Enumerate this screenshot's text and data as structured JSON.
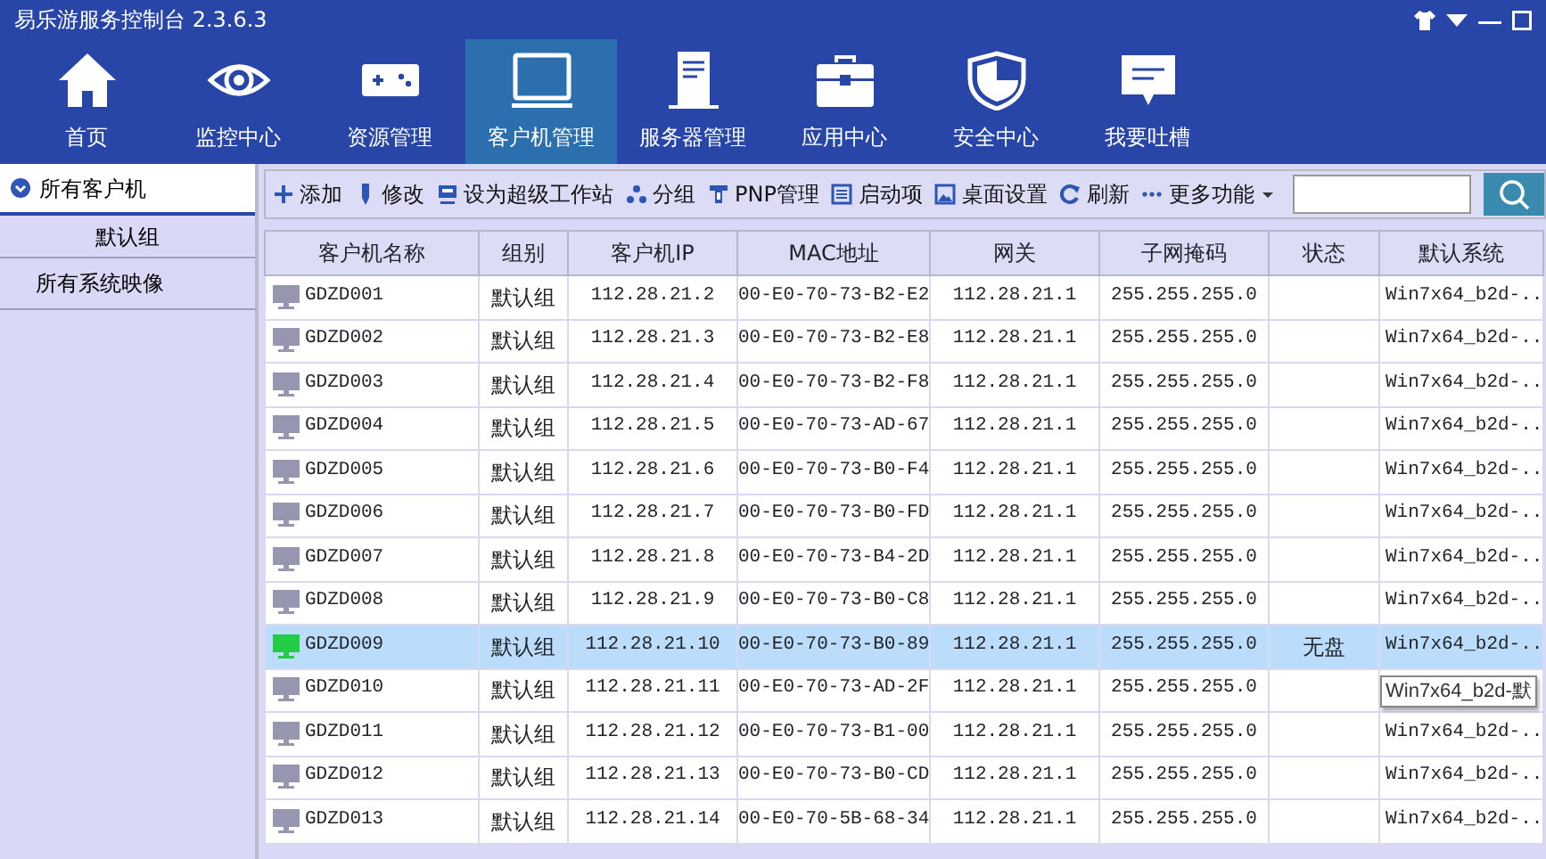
{
  "window": {
    "title": "易乐游服务控制台 2.3.6.3"
  },
  "nav": [
    {
      "label": "首页",
      "kind": "home",
      "selected": false
    },
    {
      "label": "监控中心",
      "kind": "eye",
      "selected": false
    },
    {
      "label": "资源管理",
      "kind": "gamepad",
      "selected": false
    },
    {
      "label": "客户机管理",
      "kind": "monitor",
      "selected": true
    },
    {
      "label": "服务器管理",
      "kind": "server",
      "selected": false
    },
    {
      "label": "应用中心",
      "kind": "toolbox",
      "selected": false
    },
    {
      "label": "安全中心",
      "kind": "shield",
      "selected": false
    },
    {
      "label": "我要吐槽",
      "kind": "comment",
      "selected": false
    }
  ],
  "sidebar": {
    "items": [
      {
        "label": "所有客户机",
        "kind": "root",
        "selected": true
      },
      {
        "label": "默认组",
        "kind": "group",
        "selected": false
      },
      {
        "label": "所有系统映像",
        "kind": "images",
        "selected": false
      }
    ]
  },
  "toolbar": {
    "buttons": [
      {
        "label": "添加",
        "kind": "plus"
      },
      {
        "label": "修改",
        "kind": "pen"
      },
      {
        "label": "设为超级工作站",
        "kind": "station"
      },
      {
        "label": "分组",
        "kind": "group"
      },
      {
        "label": "PNP管理",
        "kind": "pnp"
      },
      {
        "label": "启动项",
        "kind": "list"
      },
      {
        "label": "桌面设置",
        "kind": "picture"
      },
      {
        "label": "刷新",
        "kind": "refresh"
      },
      {
        "label": "更多功能",
        "kind": "more"
      }
    ]
  },
  "table": {
    "columns": [
      "客户机名称",
      "组别",
      "客户机IP",
      "MAC地址",
      "网关",
      "子网掩码",
      "状态",
      "默认系统"
    ],
    "rows": [
      {
        "name": "GDZD001",
        "group": "默认组",
        "ip": "112.28.21.2",
        "mac": "00-E0-70-73-B2-E2",
        "gateway": "112.28.21.1",
        "mask": "255.255.255.0",
        "system": "Win7x64_b2d-..",
        "online": false,
        "selected": false
      },
      {
        "name": "GDZD002",
        "group": "默认组",
        "ip": "112.28.21.3",
        "mac": "00-E0-70-73-B2-E8",
        "gateway": "112.28.21.1",
        "mask": "255.255.255.0",
        "system": "Win7x64_b2d-..",
        "online": false,
        "selected": false
      },
      {
        "name": "GDZD003",
        "group": "默认组",
        "ip": "112.28.21.4",
        "mac": "00-E0-70-73-B2-F8",
        "gateway": "112.28.21.1",
        "mask": "255.255.255.0",
        "system": "Win7x64_b2d-..",
        "online": false,
        "selected": false
      },
      {
        "name": "GDZD004",
        "group": "默认组",
        "ip": "112.28.21.5",
        "mac": "00-E0-70-73-AD-67",
        "gateway": "112.28.21.1",
        "mask": "255.255.255.0",
        "system": "Win7x64_b2d-..",
        "online": false,
        "selected": false
      },
      {
        "name": "GDZD005",
        "group": "默认组",
        "ip": "112.28.21.6",
        "mac": "00-E0-70-73-B0-F4",
        "gateway": "112.28.21.1",
        "mask": "255.255.255.0",
        "system": "Win7x64_b2d-..",
        "online": false,
        "selected": false
      },
      {
        "name": "GDZD006",
        "group": "默认组",
        "ip": "112.28.21.7",
        "mac": "00-E0-70-73-B0-FD",
        "gateway": "112.28.21.1",
        "mask": "255.255.255.0",
        "system": "Win7x64_b2d-..",
        "online": false,
        "selected": false
      },
      {
        "name": "GDZD007",
        "group": "默认组",
        "ip": "112.28.21.8",
        "mac": "00-E0-70-73-B4-2D",
        "gateway": "112.28.21.1",
        "mask": "255.255.255.0",
        "system": "Win7x64_b2d-..",
        "online": false,
        "selected": false
      },
      {
        "name": "GDZD008",
        "group": "默认组",
        "ip": "112.28.21.9",
        "mac": "00-E0-70-73-B0-C8",
        "gateway": "112.28.21.1",
        "mask": "255.255.255.0",
        "system": "Win7x64_b2d-..",
        "online": false,
        "selected": false
      },
      {
        "name": "GDZD009",
        "group": "默认组",
        "ip": "112.28.21.10",
        "mac": "00-E0-70-73-B0-89",
        "gateway": "112.28.21.1",
        "mask": "255.255.255.0",
        "status": "无盘",
        "system": "Win7x64_b2d-..",
        "online": true,
        "selected": true
      },
      {
        "name": "GDZD010",
        "group": "默认组",
        "ip": "112.28.21.11",
        "mac": "00-E0-70-73-AD-2F",
        "gateway": "112.28.21.1",
        "mask": "255.255.255.0",
        "tooltip": "Win7x64_b2d-默",
        "online": false,
        "selected": false
      },
      {
        "name": "GDZD011",
        "group": "默认组",
        "ip": "112.28.21.12",
        "mac": "00-E0-70-73-B1-00",
        "gateway": "112.28.21.1",
        "mask": "255.255.255.0",
        "system": "Win7x64_b2d-..",
        "online": false,
        "selected": false
      },
      {
        "name": "GDZD012",
        "group": "默认组",
        "ip": "112.28.21.13",
        "mac": "00-E0-70-73-B0-CD",
        "gateway": "112.28.21.1",
        "mask": "255.255.255.0",
        "system": "Win7x64_b2d-..",
        "online": false,
        "selected": false
      },
      {
        "name": "GDZD013",
        "group": "默认组",
        "ip": "112.28.21.14",
        "mac": "00-E0-70-5B-68-34",
        "gateway": "112.28.21.1",
        "mask": "255.255.255.0",
        "system": "Win7x64_b2d-..",
        "online": false,
        "selected": false
      }
    ]
  }
}
